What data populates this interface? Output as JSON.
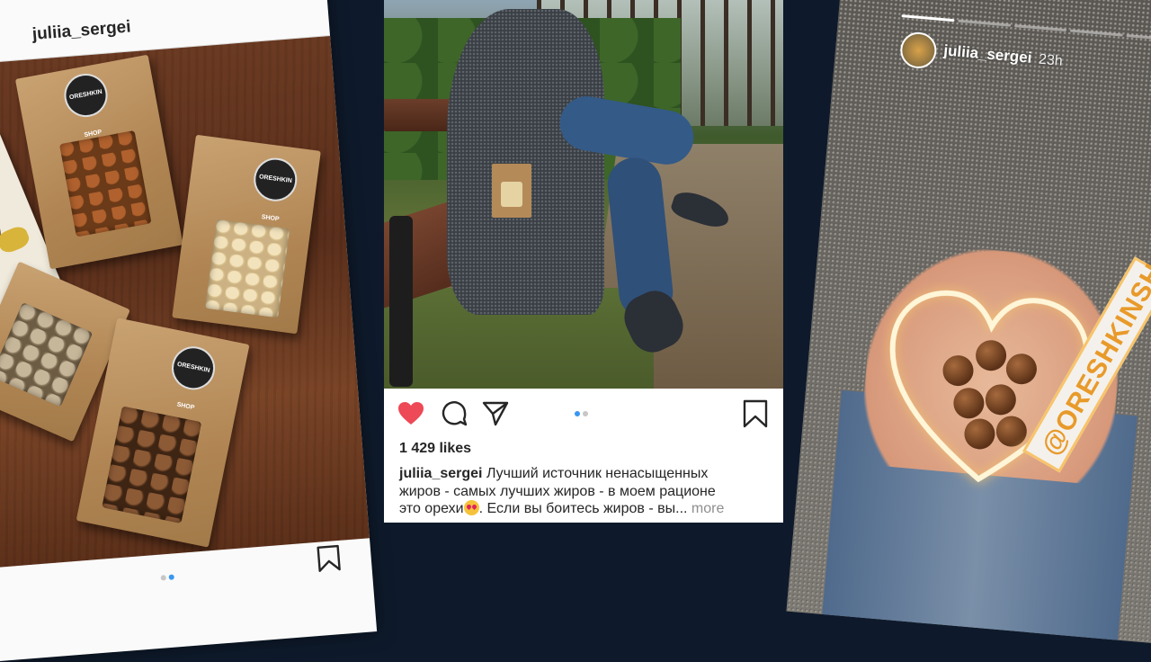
{
  "left_post": {
    "username": "juliia_sergei",
    "menu": "···",
    "bag_logo": "ORESHKIN SHOP"
  },
  "center_post": {
    "likes": "1 429 likes",
    "caption_user": "juliia_sergei",
    "caption_line1": " Лучший источник ненасыщенных",
    "caption_line2": "жиров - самых лучших жиров - в моем рационе",
    "caption_line3a": "это орехи",
    "caption_line3b": ". Если вы боитесь жиров - вы...",
    "more": "more",
    "liked": true,
    "carousel_pages": 2,
    "carousel_active": 0
  },
  "story": {
    "username": "juliia_sergei",
    "time": "23h",
    "sticker": "@ORESHKINSHOP",
    "progress_bars": 5,
    "progress_active": 1
  },
  "colors": {
    "background": "#0e1a2b",
    "like_red": "#ed4956",
    "dot_active": "#3897f0"
  }
}
